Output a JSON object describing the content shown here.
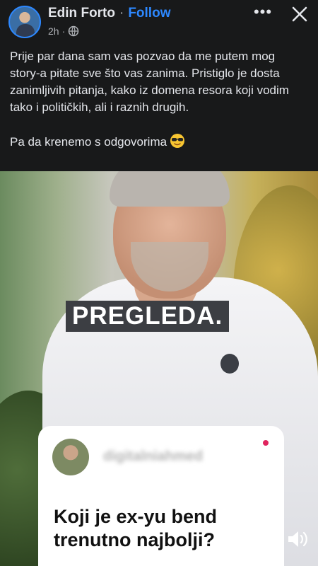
{
  "header": {
    "author_name": "Edin Forto",
    "separator": "·",
    "follow_label": "Follow",
    "time": "2h",
    "meta_separator": "·",
    "privacy_icon": "globe-icon",
    "more_icon": "more-options-icon",
    "close_icon": "close-icon"
  },
  "post": {
    "text": "Prije par dana sam vas pozvao da me putem mog story-a pitate sve što vas zanima. Pristiglo je dosta zanimljivih pitanja, kako iz domena resora koji vodim tako i političkih, ali i raznih drugih.\n\nPa da krenemo s odgovorima",
    "emoji": "smiling-face-with-sunglasses"
  },
  "video": {
    "caption": "PREGLEDA.",
    "question_card": {
      "username": "digitalniahmed",
      "question": "Koji je ex-yu bend trenutno najbolji?"
    },
    "volume_icon": "volume-icon"
  },
  "colors": {
    "background": "#18191a",
    "link_blue": "#2d88ff",
    "text_primary": "#e4e6eb",
    "text_secondary": "#b0b3b8"
  }
}
